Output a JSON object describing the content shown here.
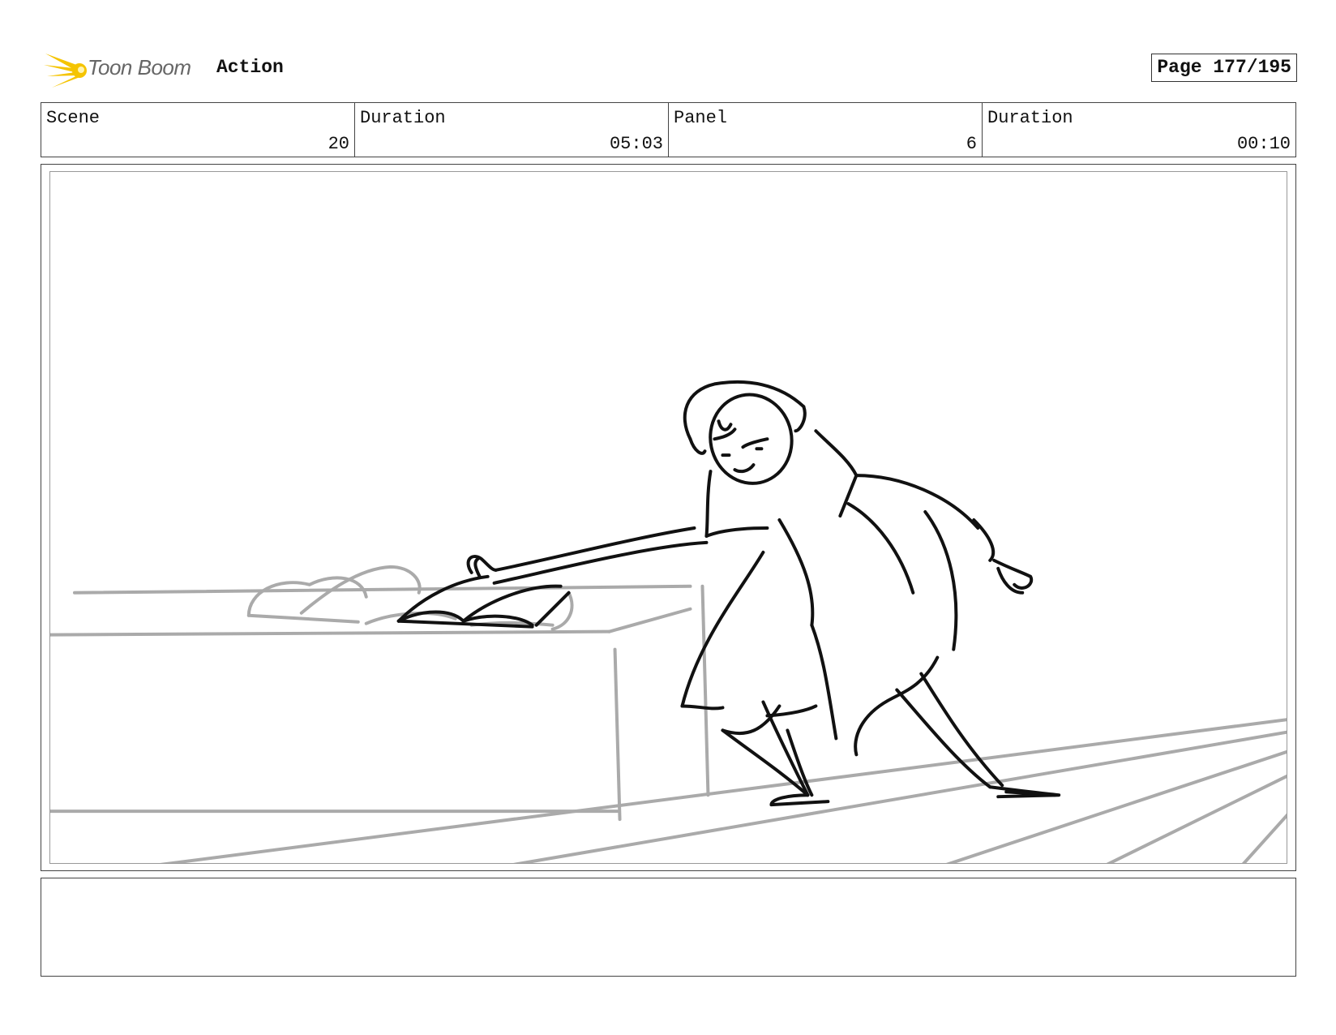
{
  "header": {
    "brand": "Toon Boom",
    "project": "Action",
    "page": "Page 177/195",
    "logo_color": "#f5c400"
  },
  "info": [
    {
      "label": "Scene",
      "value": "20"
    },
    {
      "label": "Duration",
      "value": "05:03"
    },
    {
      "label": "Panel",
      "value": "6"
    },
    {
      "label": "Duration",
      "value": "00:10"
    }
  ],
  "panel": {
    "line_color": "#111111",
    "background_line_color": "#aaaaaa"
  },
  "notes": {
    "text": ""
  }
}
